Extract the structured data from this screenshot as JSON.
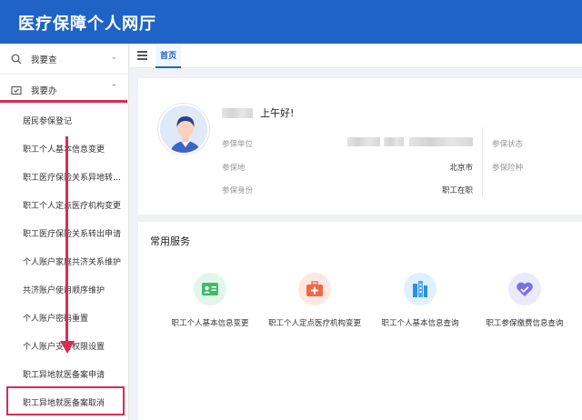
{
  "app": {
    "title": "医疗保障个人网厅"
  },
  "sidebar": {
    "groups": [
      {
        "label": "我要查",
        "icon": "search-icon",
        "expanded": false
      },
      {
        "label": "我要办",
        "icon": "folder-check-icon",
        "expanded": true
      }
    ],
    "items": [
      {
        "label": "居民参保登记"
      },
      {
        "label": "职工个人基本信息变更"
      },
      {
        "label": "职工医疗保险关系异地转…"
      },
      {
        "label": "职工个人定点医疗机构变更"
      },
      {
        "label": "职工医疗保险关系转出申请"
      },
      {
        "label": "个人账户家庭共济关系维护"
      },
      {
        "label": "共济账户使用顺序维护"
      },
      {
        "label": "个人账户密码重置"
      },
      {
        "label": "个人账户支付权限设置"
      },
      {
        "label": "职工异地就医备案申请"
      },
      {
        "label": "职工异地就医备案取消"
      }
    ]
  },
  "tabs": [
    {
      "label": "首页",
      "active": true
    }
  ],
  "user_card": {
    "greeting": "上午好!",
    "fields": [
      {
        "label": "参保单位",
        "value": ""
      },
      {
        "label": "参保地",
        "value": "北京市"
      },
      {
        "label": "参保身份",
        "value": "职工在职"
      },
      {
        "label": "参保状态",
        "value": ""
      },
      {
        "label": "参保险种",
        "value": ""
      }
    ]
  },
  "services": {
    "title": "常用服务",
    "items": [
      {
        "label": "职工个人基本信息变更",
        "icon": "id-card-icon",
        "color": "#3dbb6a",
        "bg": "#e3f6ea"
      },
      {
        "label": "职工个人定点医疗机构变更",
        "icon": "medical-kit-icon",
        "color": "#f0684a",
        "bg": "#fde8e2"
      },
      {
        "label": "职工个人基本信息查询",
        "icon": "building-icon",
        "color": "#2c8fe3",
        "bg": "#e0f0fc"
      },
      {
        "label": "职工参保缴费信息查询",
        "icon": "heart-check-icon",
        "color": "#7b6fe8",
        "bg": "#ebe9fc"
      }
    ]
  },
  "colors": {
    "brand": "#1f63c6",
    "annotation": "#d62d57"
  }
}
